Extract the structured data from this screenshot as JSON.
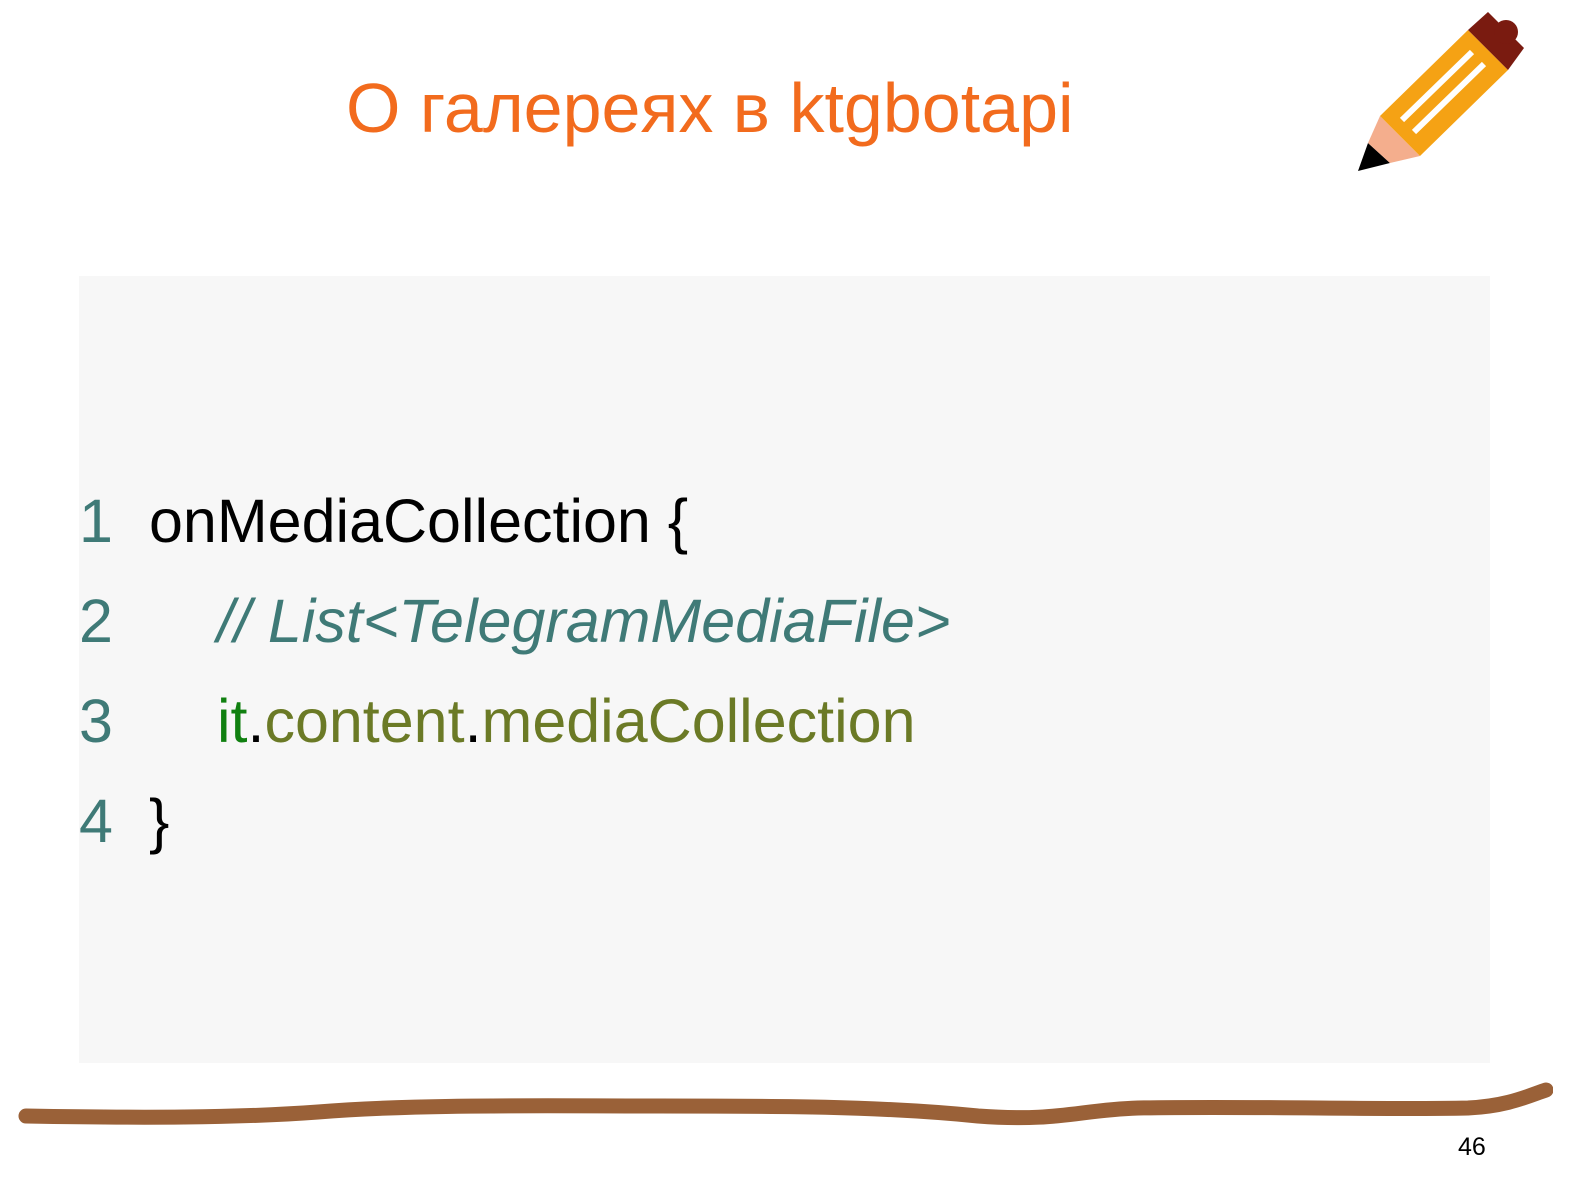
{
  "slide": {
    "title": "О галереях в ktgbotapi",
    "page_number": "46"
  },
  "code": {
    "lines": [
      {
        "number": "1",
        "text": "onMediaCollection {"
      },
      {
        "number": "2",
        "comment": "// List<TelegramMediaFile>"
      },
      {
        "number": "3",
        "keyword": "it",
        "dot1": ".",
        "prop1": "content",
        "dot2": ".",
        "prop2": "mediaCollection"
      },
      {
        "number": "4",
        "text": "}"
      }
    ]
  },
  "colors": {
    "title": "#f26b1d",
    "line_number": "#3f7a77",
    "comment": "#3f7a77",
    "keyword": "#108010",
    "property": "#6b7a26",
    "code_background": "#f7f7f7",
    "stroke": "#9a6138"
  },
  "icons": [
    "pencil-icon"
  ]
}
